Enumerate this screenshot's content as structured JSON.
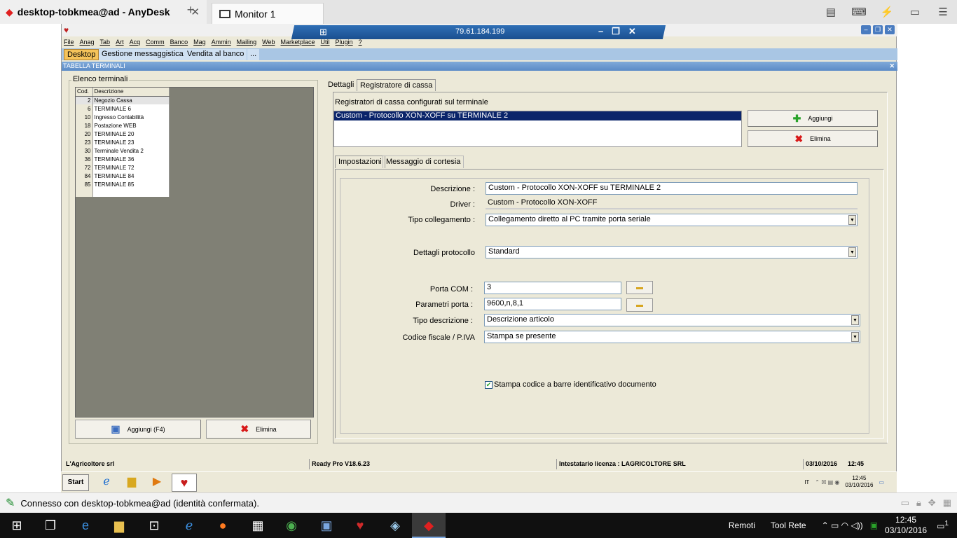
{
  "anydesk": {
    "tab_title": "desktop-tobkmea@ad - AnyDesk",
    "monitor_tab": "Monitor 1",
    "remote_ip": "79.61.184.199",
    "status_text": "Connesso con desktop-tobkmea@ad (identità confermata)."
  },
  "readypro": {
    "menu": [
      "File",
      "Anag",
      "Tab",
      "Art",
      "Acq",
      "Comm",
      "Banco",
      "Mag",
      "Ammin",
      "Mailing",
      "Web",
      "Marketplace",
      "Util",
      "Plugin",
      "?"
    ],
    "tabs": [
      "Desktop",
      "Gestione messaggistica",
      "Vendita al banco",
      "..."
    ],
    "form_title": "TABELLA TERMINALI",
    "left_group_label": "Elenco terminali",
    "table": {
      "headers": [
        "Cod.",
        "Descrizione"
      ],
      "rows": [
        [
          "2",
          "Negozio Cassa"
        ],
        [
          "6",
          "TERMINALE 6"
        ],
        [
          "10",
          "Ingresso Contabilità"
        ],
        [
          "18",
          "Postazione WEB"
        ],
        [
          "20",
          "TERMINALE 20"
        ],
        [
          "23",
          "TERMINALE 23"
        ],
        [
          "30",
          "Terminale Vendita 2"
        ],
        [
          "36",
          "TERMINALE 36"
        ],
        [
          "72",
          "TERMINALE 72"
        ],
        [
          "84",
          "TERMINALE 84"
        ],
        [
          "85",
          "TERMINALE 85"
        ]
      ]
    },
    "left_buttons": {
      "add": "Aggiungi (F4)",
      "delete": "Elimina"
    },
    "right_tabs": [
      "Dettagli",
      "Registratore di cassa"
    ],
    "registratori_label": "Registratori di cassa configurati sul terminale",
    "registratori": [
      "Custom - Protocollo XON-XOFF su TERMINALE 2"
    ],
    "right_buttons": {
      "add": "Aggiungi",
      "delete": "Elimina"
    },
    "inner_tabs": [
      "Impostazioni",
      "Messaggio di cortesia"
    ],
    "form": {
      "descrizione_label": "Descrizione :",
      "descrizione": "Custom - Protocollo XON-XOFF su TERMINALE 2",
      "driver_label": "Driver :",
      "driver": "Custom - Protocollo XON-XOFF",
      "tipo_collegamento_label": "Tipo collegamento :",
      "tipo_collegamento": "Collegamento diretto al PC tramite porta seriale",
      "dettagli_protocollo_label": "Dettagli protocollo",
      "dettagli_protocollo": "Standard",
      "porta_com_label": "Porta COM :",
      "porta_com": "3",
      "parametri_porta_label": "Parametri porta :",
      "parametri_porta": "9600,n,8,1",
      "tipo_descrizione_label": "Tipo descrizione :",
      "tipo_descrizione": "Descrizione articolo",
      "codice_fiscale_label": "Codice fiscale / P.IVA",
      "codice_fiscale": "Stampa se presente",
      "checkbox_label": "Stampa codice a barre identificativo documento",
      "checkbox_checked": true
    },
    "status": {
      "company": "L'Agricoltore srl",
      "version": "Ready Pro V18.6.23",
      "license": "Intestatario licenza : LAGRICOLTORE SRL",
      "date": "03/10/2016",
      "time": "12:45"
    },
    "xp_taskbar": {
      "start": "Start",
      "lang": "IT",
      "time": "12:45",
      "date": "03/10/2016"
    }
  },
  "windows": {
    "links": [
      "Remoti",
      "Tool Rete"
    ],
    "time": "12:45",
    "date": "03/10/2016",
    "notifications": "1"
  }
}
